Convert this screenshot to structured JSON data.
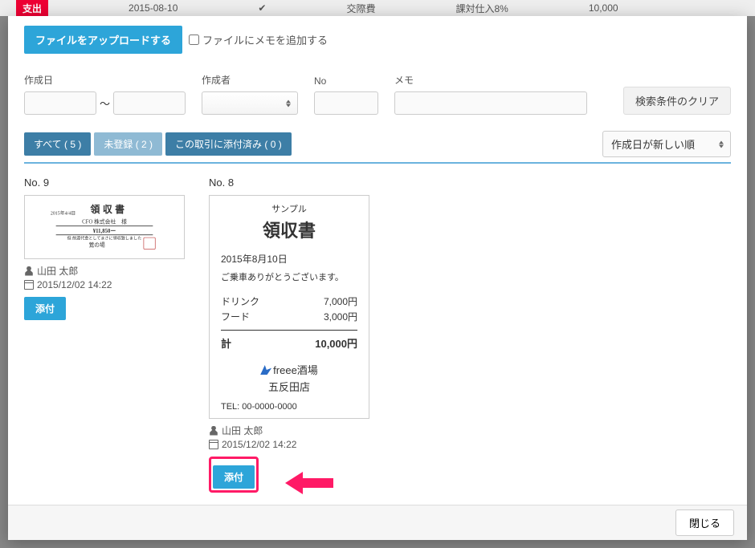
{
  "bg": {
    "tag": "支出",
    "date": "2015-08-10",
    "category": "交際費",
    "tax": "課対仕入8%",
    "amount": "10,000"
  },
  "upload": {
    "button": "ファイルをアップロードする",
    "memo_checkbox": "ファイルにメモを追加する"
  },
  "filters": {
    "date_label": "作成日",
    "date_sep": "〜",
    "author_label": "作成者",
    "no_label": "No",
    "memo_label": "メモ",
    "clear": "検索条件のクリア"
  },
  "tabs": {
    "all": "すべて ( 5 )",
    "unregistered": "未登録 ( 2 )",
    "attached": "この取引に添付済み ( 0 )"
  },
  "sort": {
    "value": "作成日が新しい順"
  },
  "cards": [
    {
      "no_label": "No. 9",
      "author": "山田 太郎",
      "timestamp": "2015/12/02 14:22",
      "attach": "添付",
      "mini": {
        "date": "2015年4/4日",
        "title": "領収書",
        "payee": "CFO 株式会社　様",
        "amount": "¥11,850ー",
        "note": "但 前渡代金としてまさに領収致しました",
        "shop": "鶯の場"
      }
    },
    {
      "no_label": "No. 8",
      "author": "山田 太郎",
      "timestamp": "2015/12/02 14:22",
      "attach": "添付",
      "receipt": {
        "sample": "サンプル",
        "title": "領収書",
        "date": "2015年8月10日",
        "greeting": "ご乗車ありがとうございます。",
        "items": [
          {
            "name": "ドリンク",
            "price": "7,000円"
          },
          {
            "name": "フード",
            "price": "3,000円"
          }
        ],
        "total_label": "計",
        "total_value": "10,000円",
        "shop": "freee酒場",
        "branch": "五反田店",
        "tel": "TEL: 00-0000-0000"
      }
    }
  ],
  "footer": {
    "close": "閉じる"
  }
}
